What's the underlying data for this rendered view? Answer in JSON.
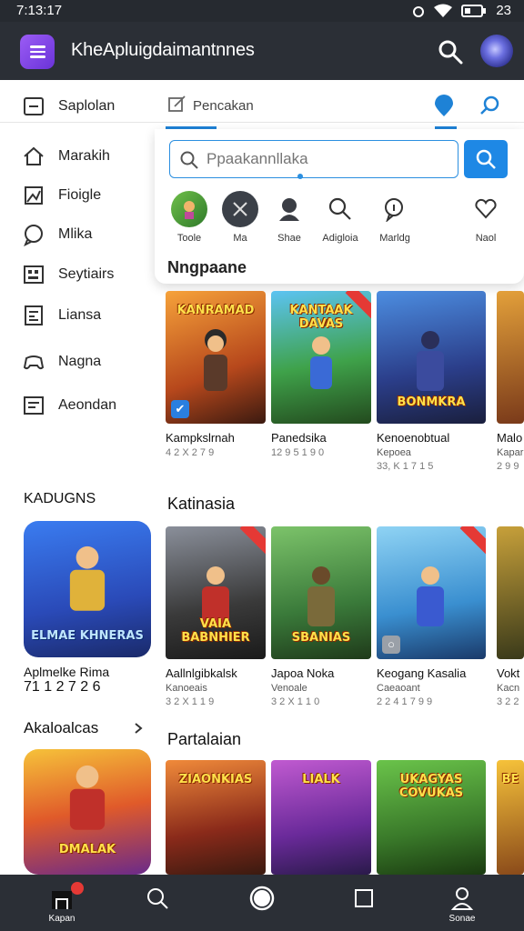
{
  "status": {
    "time": "7:13:17",
    "battery": "23"
  },
  "app": {
    "title": "KheApluigdaimantnnes"
  },
  "sidebar": {
    "items": [
      {
        "label": "Saplolan",
        "icon": "minus-square-icon"
      },
      {
        "label": "Marakih",
        "icon": "house-icon"
      },
      {
        "label": "Fioigle",
        "icon": "image-frame-icon"
      },
      {
        "label": "Mlika",
        "icon": "chat-bubble-icon"
      },
      {
        "label": "Seytiairs",
        "icon": "grid-box-icon"
      },
      {
        "label": "Liansa",
        "icon": "calendar-icon"
      },
      {
        "label": "Nagna",
        "icon": "gamepad-icon"
      },
      {
        "label": "Aeondan",
        "icon": "list-doc-icon"
      }
    ]
  },
  "tabs": {
    "active_label": "Pencakan"
  },
  "search": {
    "placeholder": "Ppaakannllaka",
    "categories": [
      "Toole",
      "Ma",
      "Shae",
      "Adigloia",
      "Marldg",
      "Naol"
    ],
    "heading": "Nngpaane"
  },
  "sections": {
    "row1_title": "",
    "left_title": "KADUGNS",
    "row2_title": "Katinasia",
    "left_title2": "Akaloalcas",
    "row3_title": "Partalaian"
  },
  "row1": [
    {
      "art": "KANRAMAD",
      "title": "Kampkslrnah",
      "sub": "",
      "meta": "4 2 X 2 7 9"
    },
    {
      "art": "KANTAAK DAVAS",
      "title": "Panedsika",
      "sub": "",
      "meta": "12 9 5 1 9 0"
    },
    {
      "art": "BONMKRA",
      "title": "Kenoenobtual",
      "sub": "Kepoea",
      "meta": "33, K 1 7 1 5"
    },
    {
      "art": "",
      "title": "Malo",
      "sub": "Kapar",
      "meta": "2 9 9"
    }
  ],
  "left_feature": {
    "art": "ELMAE KHNERAS",
    "title": "Aplmelke Rima",
    "meta": "71 1 2 7 2 6"
  },
  "row2": [
    {
      "art": "VAIA BABNHIER",
      "title": "Aallnlgibkalsk",
      "sub": "Kanoeais",
      "meta": "3 2 X 1 1 9"
    },
    {
      "art": "SBANIAS",
      "title": "Japoa Noka",
      "sub": "Venoale",
      "meta": "3 2 X 1 1 0"
    },
    {
      "art": "",
      "title": "Keogang Kasalia",
      "sub": "Caeaoant",
      "meta": "2 2 4 1 7 9 9"
    },
    {
      "art": "",
      "title": "Vokt",
      "sub": "Kacn",
      "meta": "3 2 2"
    }
  ],
  "left_feature2": {
    "art": "DMALAK"
  },
  "row3": [
    {
      "art": "ZIAONKIAS"
    },
    {
      "art": "LIALK"
    },
    {
      "art": "UKAGYAS COVUKAS"
    },
    {
      "art": "BE"
    }
  ],
  "bottom_nav": {
    "home": "Kapan",
    "profile": "Sonae",
    "notification_count": ""
  }
}
